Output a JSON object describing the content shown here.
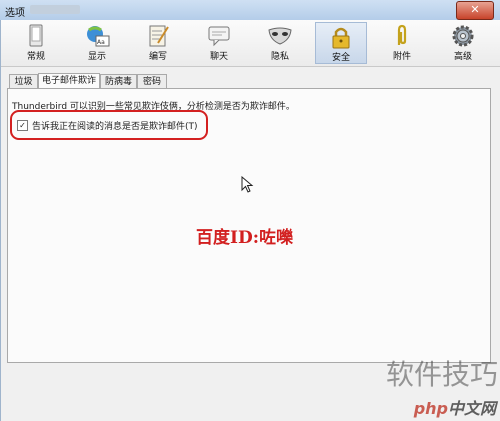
{
  "window": {
    "title": "选项",
    "close_label": "✕"
  },
  "toolbar": {
    "items": [
      {
        "label": "常规",
        "icon": "general-icon"
      },
      {
        "label": "显示",
        "icon": "display-icon"
      },
      {
        "label": "编写",
        "icon": "compose-icon"
      },
      {
        "label": "聊天",
        "icon": "chat-icon"
      },
      {
        "label": "隐私",
        "icon": "privacy-icon"
      },
      {
        "label": "安全",
        "icon": "security-icon",
        "active": true
      },
      {
        "label": "附件",
        "icon": "attachment-icon"
      },
      {
        "label": "高级",
        "icon": "advanced-icon"
      }
    ]
  },
  "tabs": [
    {
      "label": "垃圾"
    },
    {
      "label": "电子邮件欺诈",
      "active": true
    },
    {
      "label": "防病毒"
    },
    {
      "label": "密码"
    }
  ],
  "panel": {
    "description": "Thunderbird 可以识别一些常见欺诈伎俩，分析检测是否为欺诈邮件。",
    "checkbox": {
      "label": "告诉我正在阅读的消息是否是欺诈邮件(T)",
      "checked": true,
      "mark": "✓"
    }
  },
  "watermarks": {
    "baidu_id": "百度ID:咗嚛",
    "tips": "软件技巧",
    "logo_php": "php",
    "logo_rest": "中文网"
  },
  "colors": {
    "highlight": "#d32020",
    "active_tab_bg": "#c8d7ea"
  }
}
